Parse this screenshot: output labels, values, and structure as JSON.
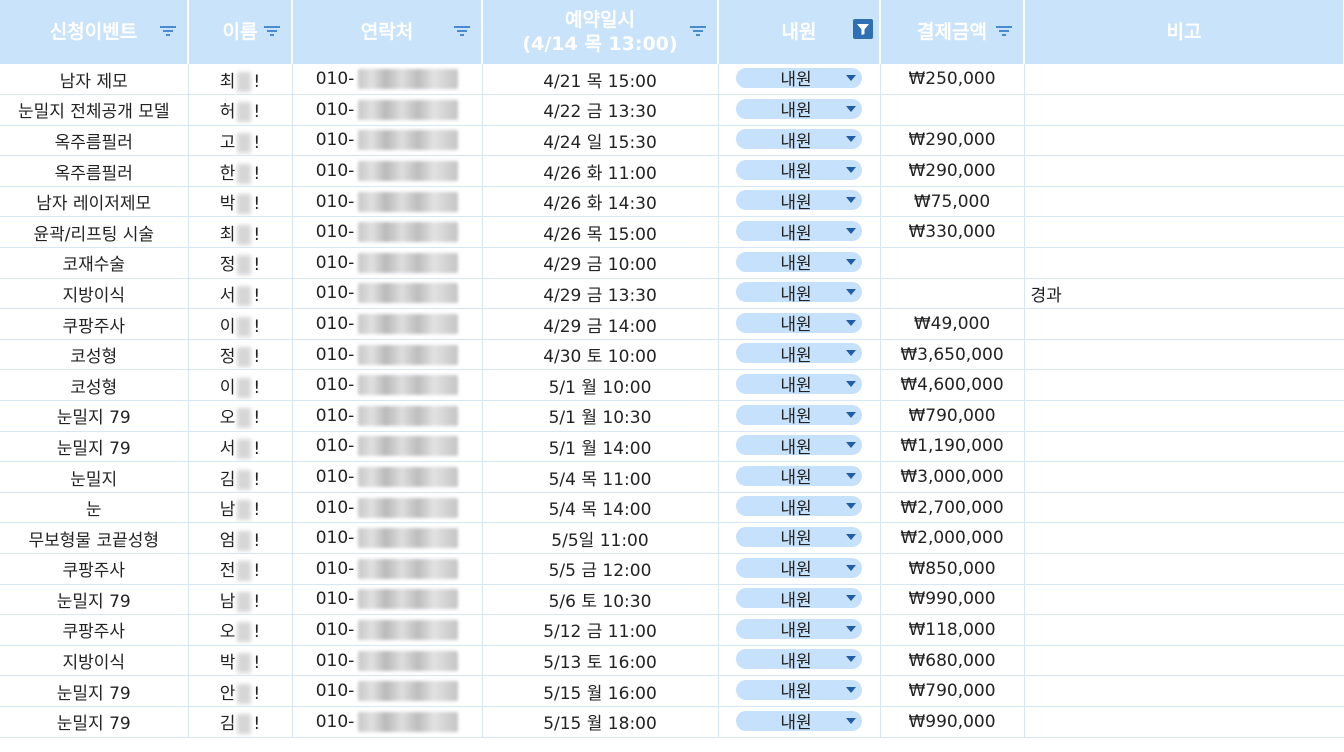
{
  "headers": [
    {
      "label": "신청이벤트"
    },
    {
      "label": "이름"
    },
    {
      "label": "연락처"
    },
    {
      "label": "예약일시\n(4/14 목 13:00)"
    },
    {
      "label": "내원"
    },
    {
      "label": "결제금액"
    },
    {
      "label": "비고"
    }
  ],
  "rows": [
    {
      "event": "남자 제모",
      "name_first": "최",
      "name_last": "!",
      "phone_prefix": "010-",
      "datetime": "4/21 목 15:00",
      "visit": "내원",
      "amount": "₩250,000",
      "note": ""
    },
    {
      "event": "눈밀지 전체공개 모델",
      "name_first": "허",
      "name_last": "!",
      "phone_prefix": "010-",
      "datetime": "4/22 금 13:30",
      "visit": "내원",
      "amount": "",
      "note": ""
    },
    {
      "event": "옥주름필러",
      "name_first": "고",
      "name_last": "!",
      "phone_prefix": "010-",
      "datetime": "4/24 일 15:30",
      "visit": "내원",
      "amount": "₩290,000",
      "note": ""
    },
    {
      "event": "옥주름필러",
      "name_first": "한",
      "name_last": "!",
      "phone_prefix": "010-",
      "datetime": "4/26 화 11:00",
      "visit": "내원",
      "amount": "₩290,000",
      "note": ""
    },
    {
      "event": "남자 레이저제모",
      "name_first": "박",
      "name_last": "!",
      "phone_prefix": "010-",
      "datetime": "4/26 화 14:30",
      "visit": "내원",
      "amount": "₩75,000",
      "note": ""
    },
    {
      "event": "윤곽/리프팅 시술",
      "name_first": "최",
      "name_last": "!",
      "phone_prefix": "010-",
      "datetime": "4/26 목 15:00",
      "visit": "내원",
      "amount": "₩330,000",
      "note": ""
    },
    {
      "event": "코재수술",
      "name_first": "정",
      "name_last": "!",
      "phone_prefix": "010-",
      "datetime": "4/29 금 10:00",
      "visit": "내원",
      "amount": "",
      "note": ""
    },
    {
      "event": "지방이식",
      "name_first": "서",
      "name_last": "!",
      "phone_prefix": "010-",
      "datetime": "4/29 금 13:30",
      "visit": "내원",
      "amount": "",
      "note": "경과"
    },
    {
      "event": "쿠팡주사",
      "name_first": "이",
      "name_last": "!",
      "phone_prefix": "010-",
      "datetime": "4/29 금 14:00",
      "visit": "내원",
      "amount": "₩49,000",
      "note": ""
    },
    {
      "event": "코성형",
      "name_first": "정",
      "name_last": "!",
      "phone_prefix": "010-",
      "datetime": "4/30 토 10:00",
      "visit": "내원",
      "amount": "₩3,650,000",
      "note": ""
    },
    {
      "event": "코성형",
      "name_first": "이",
      "name_last": "!",
      "phone_prefix": "010-",
      "datetime": "5/1 월 10:00",
      "visit": "내원",
      "amount": "₩4,600,000",
      "note": ""
    },
    {
      "event": "눈밀지 79",
      "name_first": "오",
      "name_last": "!",
      "phone_prefix": "010-",
      "datetime": "5/1 월 10:30",
      "visit": "내원",
      "amount": "₩790,000",
      "note": ""
    },
    {
      "event": "눈밀지 79",
      "name_first": "서",
      "name_last": "!",
      "phone_prefix": "010-",
      "datetime": "5/1 월 14:00",
      "visit": "내원",
      "amount": "₩1,190,000",
      "note": ""
    },
    {
      "event": "눈밀지",
      "name_first": "김",
      "name_last": "!",
      "phone_prefix": "010-",
      "datetime": "5/4 목 11:00",
      "visit": "내원",
      "amount": "₩3,000,000",
      "note": ""
    },
    {
      "event": "눈",
      "name_first": "남",
      "name_last": "!",
      "phone_prefix": "010-",
      "datetime": "5/4 목 14:00",
      "visit": "내원",
      "amount": "₩2,700,000",
      "note": ""
    },
    {
      "event": "무보형물 코끝성형",
      "name_first": "엄",
      "name_last": "!",
      "phone_prefix": "010-",
      "datetime": "5/5일 11:00",
      "visit": "내원",
      "amount": "₩2,000,000",
      "note": ""
    },
    {
      "event": "쿠팡주사",
      "name_first": "전",
      "name_last": "!",
      "phone_prefix": "010-",
      "datetime": "5/5 금 12:00",
      "visit": "내원",
      "amount": "₩850,000",
      "note": ""
    },
    {
      "event": "눈밀지 79",
      "name_first": "남",
      "name_last": "!",
      "phone_prefix": "010-",
      "datetime": "5/6 토 10:30",
      "visit": "내원",
      "amount": "₩990,000",
      "note": ""
    },
    {
      "event": "쿠팡주사",
      "name_first": "오",
      "name_last": "!",
      "phone_prefix": "010-",
      "datetime": "5/12 금 11:00",
      "visit": "내원",
      "amount": "₩118,000",
      "note": ""
    },
    {
      "event": "지방이식",
      "name_first": "박",
      "name_last": "!",
      "phone_prefix": "010-",
      "datetime": "5/13 토 16:00",
      "visit": "내원",
      "amount": "₩680,000",
      "note": ""
    },
    {
      "event": "눈밀지 79",
      "name_first": "안",
      "name_last": "!",
      "phone_prefix": "010-",
      "datetime": "5/15 월 16:00",
      "visit": "내원",
      "amount": "₩790,000",
      "note": ""
    },
    {
      "event": "눈밀지 79",
      "name_first": "김",
      "name_last": "!",
      "phone_prefix": "010-",
      "datetime": "5/15 월 18:00",
      "visit": "내원",
      "amount": "₩990,000",
      "note": ""
    }
  ],
  "colors": {
    "header_bg": "#c9e3fb",
    "dropdown_bg": "#c6e1fb",
    "filter_active": "#2f6fb3",
    "grid": "#d7e6f5"
  },
  "icons": {
    "filter": "filter-icon",
    "filter_active": "filter-active-icon",
    "dropdown": "chevron-down-icon"
  }
}
